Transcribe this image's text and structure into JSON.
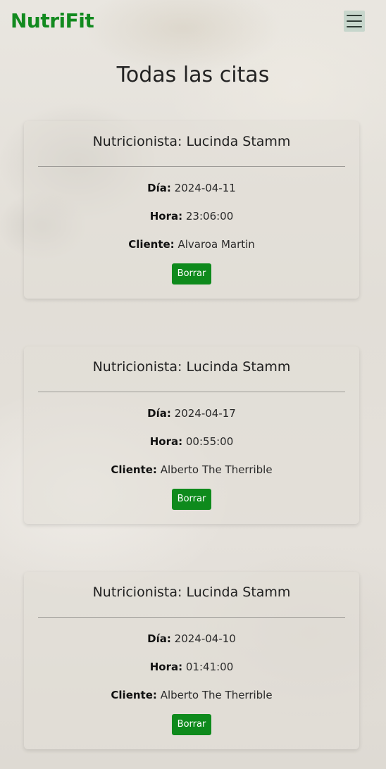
{
  "header": {
    "brand": "NutriFit",
    "menu_icon": "hamburger-menu-icon"
  },
  "page": {
    "title": "Todas las citas"
  },
  "labels": {
    "day": "Día:",
    "hour": "Hora:",
    "client": "Cliente:",
    "delete_button": "Borrar"
  },
  "appointments": [
    {
      "nutritionist": "Nutricionista: Lucinda Stamm",
      "day": "2024-04-11",
      "hour": "23:06:00",
      "client": "Alvaroa Martin"
    },
    {
      "nutritionist": "Nutricionista: Lucinda Stamm",
      "day": "2024-04-17",
      "hour": "00:55:00",
      "client": "Alberto The Therrible"
    },
    {
      "nutritionist": "Nutricionista: Lucinda Stamm",
      "day": "2024-04-10",
      "hour": "01:41:00",
      "client": "Alberto The Therrible"
    }
  ],
  "colors": {
    "brand": "#128a1f",
    "button": "#0e8a1c",
    "toggler_bg": "#c7d6cc"
  }
}
